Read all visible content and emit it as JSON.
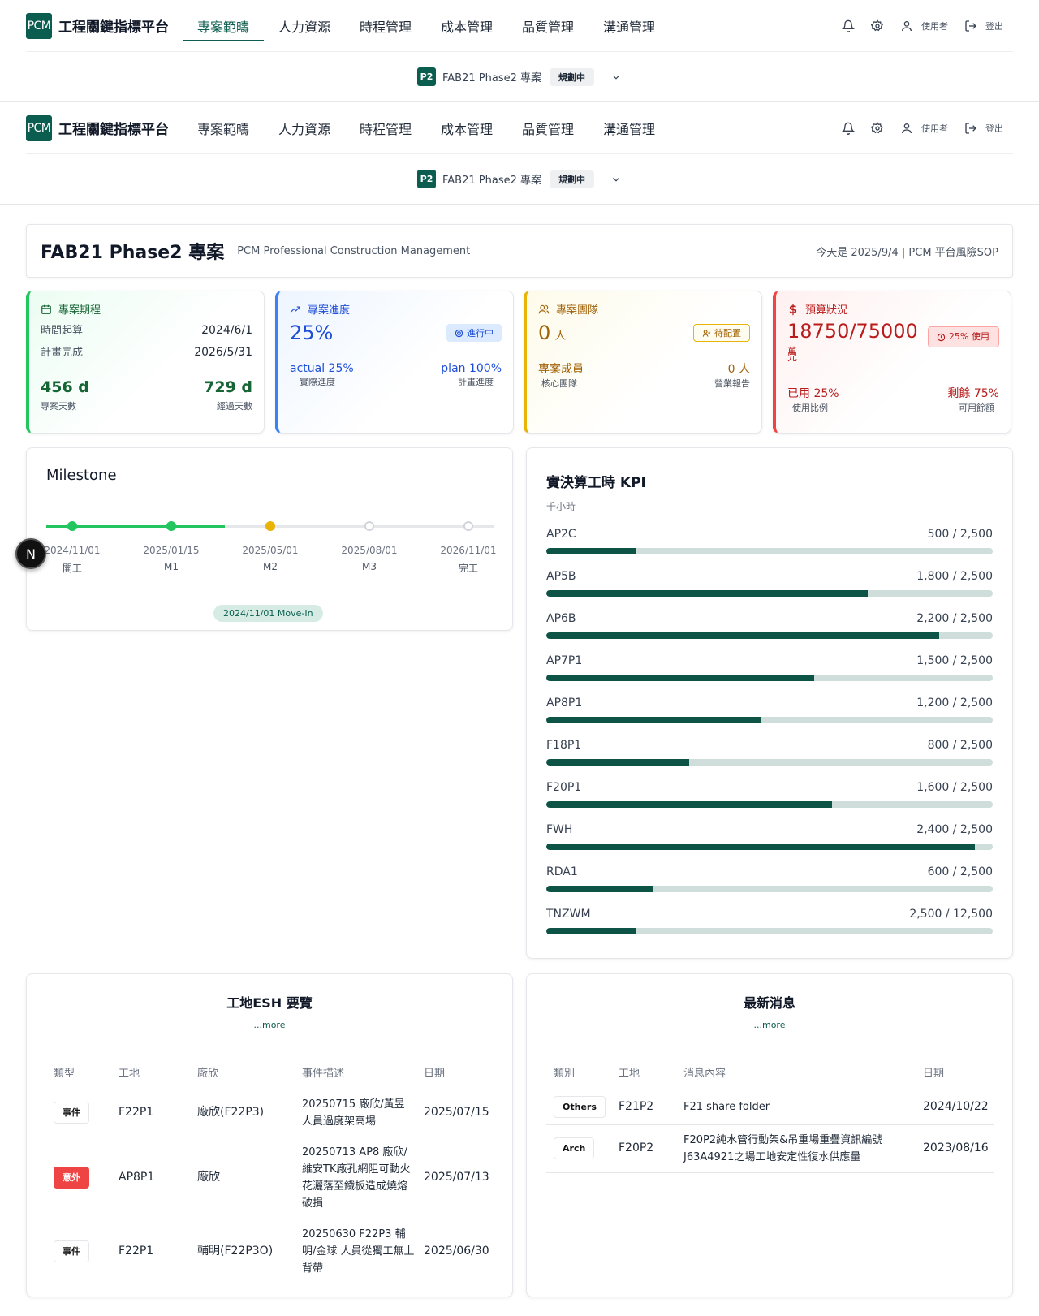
{
  "brand": {
    "logo": "PCM",
    "name": "工程關鍵指標平台"
  },
  "nav": {
    "tabs": [
      "專案範疇",
      "人力資源",
      "時程管理",
      "成本管理",
      "品質管理",
      "溝通管理"
    ],
    "active_index": 0,
    "user_label": "使用者",
    "logout_label": "登出"
  },
  "project_bar": {
    "code": "P2",
    "name": "FAB21 Phase2 專案",
    "status": "規劃中"
  },
  "header": {
    "title": "FAB21 Phase2 專案",
    "subtitle": "PCM Professional Construction Management",
    "right_text": "今天是 2025/9/4 | PCM 平台風險SOP"
  },
  "stats": {
    "period": {
      "title": "專案期程",
      "start_label": "時間起算",
      "start_value": "2024/6/1",
      "end_label": "計畫完成",
      "end_value": "2026/5/31",
      "days_value": "456 d",
      "days_label": "專案天數",
      "elapsed_value": "729 d",
      "elapsed_label": "經過天數"
    },
    "progress": {
      "title": "專案進度",
      "value": "25%",
      "status": "進行中",
      "actual_value": "actual 25%",
      "actual_label": "實際進度",
      "plan_value": "plan 100%",
      "plan_label": "計畫進度"
    },
    "team": {
      "title": "專案團隊",
      "value": "0",
      "unit": "人",
      "status": "待配置",
      "members_label": "專案成員",
      "members_sub": "核心團隊",
      "report_value": "0 人",
      "report_sub": "營業報告"
    },
    "budget": {
      "title": "預算狀況",
      "value": "18750/75000",
      "unit_a": "萬",
      "unit_b": "元",
      "pill": "25% 使用",
      "used_value": "已用 25%",
      "used_label": "使用比例",
      "remain_value": "剩餘 75%",
      "remain_label": "可用餘額"
    }
  },
  "milestone": {
    "title": "Milestone",
    "items": [
      {
        "date": "2024/11/01",
        "name": "開工",
        "state": "done"
      },
      {
        "date": "2025/01/15",
        "name": "M1",
        "state": "done"
      },
      {
        "date": "2025/05/01",
        "name": "M2",
        "state": "current"
      },
      {
        "date": "2025/08/01",
        "name": "M3",
        "state": "pending"
      },
      {
        "date": "2026/11/01",
        "name": "完工",
        "state": "pending"
      }
    ],
    "pill": "2024/11/01 Move-In",
    "floating_button": "N"
  },
  "kpi": {
    "title": "實決算工時 KPI",
    "unit": "千小時",
    "items": [
      {
        "name": "AP2C",
        "value": 500,
        "total": 2500,
        "label": "500 / 2,500"
      },
      {
        "name": "AP5B",
        "value": 1800,
        "total": 2500,
        "label": "1,800 / 2,500"
      },
      {
        "name": "AP6B",
        "value": 2200,
        "total": 2500,
        "label": "2,200 / 2,500"
      },
      {
        "name": "AP7P1",
        "value": 1500,
        "total": 2500,
        "label": "1,500 / 2,500"
      },
      {
        "name": "AP8P1",
        "value": 1200,
        "total": 2500,
        "label": "1,200 / 2,500"
      },
      {
        "name": "F18P1",
        "value": 800,
        "total": 2500,
        "label": "800 / 2,500"
      },
      {
        "name": "F20P1",
        "value": 1600,
        "total": 2500,
        "label": "1,600 / 2,500"
      },
      {
        "name": "FWH",
        "value": 2400,
        "total": 2500,
        "label": "2,400 / 2,500"
      },
      {
        "name": "RDA1",
        "value": 600,
        "total": 2500,
        "label": "600 / 2,500"
      },
      {
        "name": "TNZWM",
        "value": 2500,
        "total": 12500,
        "label": "2,500 / 12,500"
      }
    ]
  },
  "esh": {
    "title": "工地ESH 要覽",
    "more": "...more",
    "headers": [
      "類型",
      "工地",
      "廠欣",
      "事件描述",
      "日期"
    ],
    "rows": [
      {
        "type": "事件",
        "alert": false,
        "site": "F22P1",
        "vendor": "廠欣(F22P3)",
        "desc": "20250715 廠欣/黃昱 人員過度架高場",
        "date": "2025/07/15"
      },
      {
        "type": "意外",
        "alert": true,
        "site": "AP8P1",
        "vendor": "廠欣",
        "desc": "20250713 AP8 廠欣/維安TK廠孔網阻可動火 花灑落至鐵板造成燒熔破損",
        "date": "2025/07/13"
      },
      {
        "type": "事件",
        "alert": false,
        "site": "F22P1",
        "vendor": "輔明(F22P3O)",
        "desc": "20250630 F22P3 輔明/金球 人員從獨工無上背帶",
        "date": "2025/06/30"
      }
    ]
  },
  "news": {
    "title": "最新消息",
    "more": "...more",
    "headers": [
      "類別",
      "工地",
      "消息內容",
      "日期"
    ],
    "rows": [
      {
        "cat": "Others",
        "site": "F21P2",
        "content": "F21 share folder",
        "date": "2024/10/22"
      },
      {
        "cat": "Arch",
        "site": "F20P2",
        "content": "F20P2純水管行動架&吊重場重疊資訊編號J63A4921之場工地安定性復水供應量",
        "date": "2023/08/16"
      }
    ]
  },
  "colors": {
    "brand": "#0b5d4f",
    "done": "#22c55e",
    "current": "#eab308",
    "pending": "#d1d5db",
    "bar": "#0d5447",
    "track": "#cfdeda"
  }
}
